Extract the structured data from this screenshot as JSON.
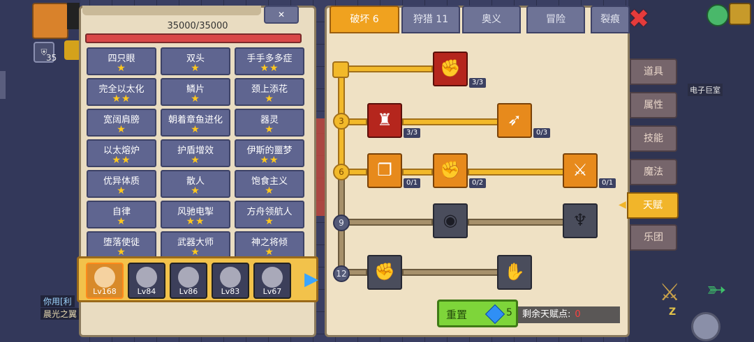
{
  "hud": {
    "currency_count": "35",
    "chat_line1": "你用[利",
    "chat_line2": "晨光之翼"
  },
  "left_panel": {
    "hp_text": "35000/35000",
    "buffs": [
      {
        "name": "四只眼",
        "stars": "★"
      },
      {
        "name": "双头",
        "stars": "★"
      },
      {
        "name": "手手多多症",
        "stars": "★★"
      },
      {
        "name": "完全以太化",
        "stars": "★★"
      },
      {
        "name": "鳞片",
        "stars": "★"
      },
      {
        "name": "颈上添花",
        "stars": "★"
      },
      {
        "name": "宽阔肩膀",
        "stars": "★"
      },
      {
        "name": "朝着章鱼进化",
        "stars": "★"
      },
      {
        "name": "器灵",
        "stars": "★"
      },
      {
        "name": "以太熔炉",
        "stars": "★★"
      },
      {
        "name": "护盾增效",
        "stars": "★"
      },
      {
        "name": "伊斯的噩梦",
        "stars": "★★"
      },
      {
        "name": "优异体质",
        "stars": "★"
      },
      {
        "name": "散人",
        "stars": "★"
      },
      {
        "name": "饱食主义",
        "stars": "★"
      },
      {
        "name": "自律",
        "stars": "★"
      },
      {
        "name": "风驰电掣",
        "stars": "★★"
      },
      {
        "name": "方舟领航人",
        "stars": "★"
      },
      {
        "name": "堕落使徒",
        "stars": "★"
      },
      {
        "name": "武器大师",
        "stars": "★"
      },
      {
        "name": "神之将倾",
        "stars": "★"
      }
    ],
    "pets": [
      {
        "level": "Lv168",
        "selected": true
      },
      {
        "level": "Lv84",
        "selected": false
      },
      {
        "level": "Lv86",
        "selected": false
      },
      {
        "level": "Lv83",
        "selected": false
      },
      {
        "level": "Lv67",
        "selected": false
      }
    ]
  },
  "talent_panel": {
    "tabs": [
      "破坏 6",
      "狩猎 11",
      "奥义",
      "冒险",
      "裂痕"
    ],
    "active_tab": 0,
    "tier_labels": [
      "3",
      "6",
      "9",
      "12"
    ],
    "nodes": [
      {
        "icon": "arm-wrestle-icon",
        "count": "3/3"
      },
      {
        "icon": "muscle-body-icon",
        "count": "3/3"
      },
      {
        "icon": "arrow-hit-icon",
        "count": "0/3"
      },
      {
        "icon": "card-swap-icon",
        "count": "0/1"
      },
      {
        "icon": "fist-punch-icon",
        "count": "0/2"
      },
      {
        "icon": "sword-splash-icon",
        "count": "0/1"
      },
      {
        "icon": "ripple-icon",
        "count": ""
      },
      {
        "icon": "bat-icon",
        "count": ""
      },
      {
        "icon": "raised-fist-icon",
        "count": ""
      },
      {
        "icon": "handshake-icon",
        "count": ""
      }
    ],
    "reset_label": "重置",
    "reset_gem_cost": "5",
    "remaining_label": "剩余天赋点:",
    "remaining_points": "0"
  },
  "side_menu": {
    "items": [
      "道具",
      "属性",
      "技能",
      "魔法",
      "天赋",
      "乐团"
    ],
    "active": 4
  },
  "right_hud": {
    "sign_label": "电子巨室",
    "z_label": "Z"
  }
}
